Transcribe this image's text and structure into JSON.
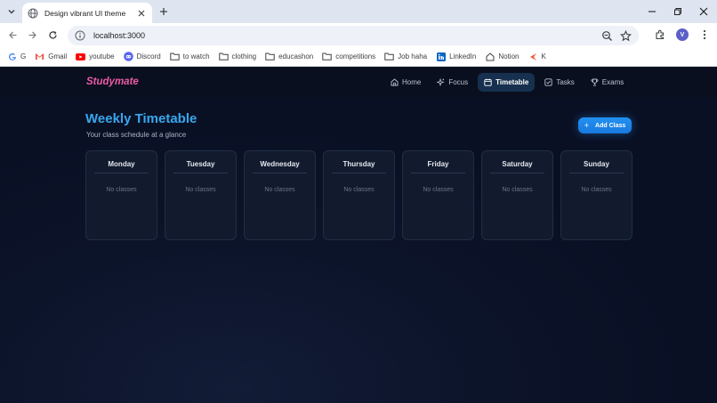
{
  "browser": {
    "tab_title": "Design vibrant UI theme",
    "url": "localhost:3000",
    "avatar_letter": "V",
    "bookmarks": [
      {
        "label": "G",
        "icon": "google-icon"
      },
      {
        "label": "Gmail",
        "icon": "gmail-icon"
      },
      {
        "label": "youtube",
        "icon": "youtube-icon"
      },
      {
        "label": "Discord",
        "icon": "discord-icon"
      },
      {
        "label": "to watch",
        "icon": "folder-icon"
      },
      {
        "label": "clothing",
        "icon": "folder-icon"
      },
      {
        "label": "educashon",
        "icon": "folder-icon"
      },
      {
        "label": "competitions",
        "icon": "folder-icon"
      },
      {
        "label": "Job haha",
        "icon": "folder-icon"
      },
      {
        "label": "LinkedIn",
        "icon": "linkedin-icon"
      },
      {
        "label": "Notion",
        "icon": "notion-icon"
      },
      {
        "label": "K",
        "icon": "k-icon"
      }
    ]
  },
  "app": {
    "brand": "Studymate",
    "nav": [
      {
        "label": "Home",
        "icon": "home-icon",
        "active": false
      },
      {
        "label": "Focus",
        "icon": "sparkle-icon",
        "active": false
      },
      {
        "label": "Timetable",
        "icon": "calendar-icon",
        "active": true
      },
      {
        "label": "Tasks",
        "icon": "checkbox-icon",
        "active": false
      },
      {
        "label": "Exams",
        "icon": "trophy-icon",
        "active": false
      }
    ],
    "page_title": "Weekly Timetable",
    "page_subtitle": "Your class schedule at a glance",
    "add_button": "Add Class",
    "days": [
      {
        "name": "Monday",
        "empty_text": "No classes"
      },
      {
        "name": "Tuesday",
        "empty_text": "No classes"
      },
      {
        "name": "Wednesday",
        "empty_text": "No classes"
      },
      {
        "name": "Thursday",
        "empty_text": "No classes"
      },
      {
        "name": "Friday",
        "empty_text": "No classes"
      },
      {
        "name": "Saturday",
        "empty_text": "No classes"
      },
      {
        "name": "Sunday",
        "empty_text": "No classes"
      }
    ],
    "colors": {
      "brand": "#ec5aa8",
      "title": "#38a7ee",
      "accent": "#1978dd",
      "background": "#0b1326"
    }
  }
}
